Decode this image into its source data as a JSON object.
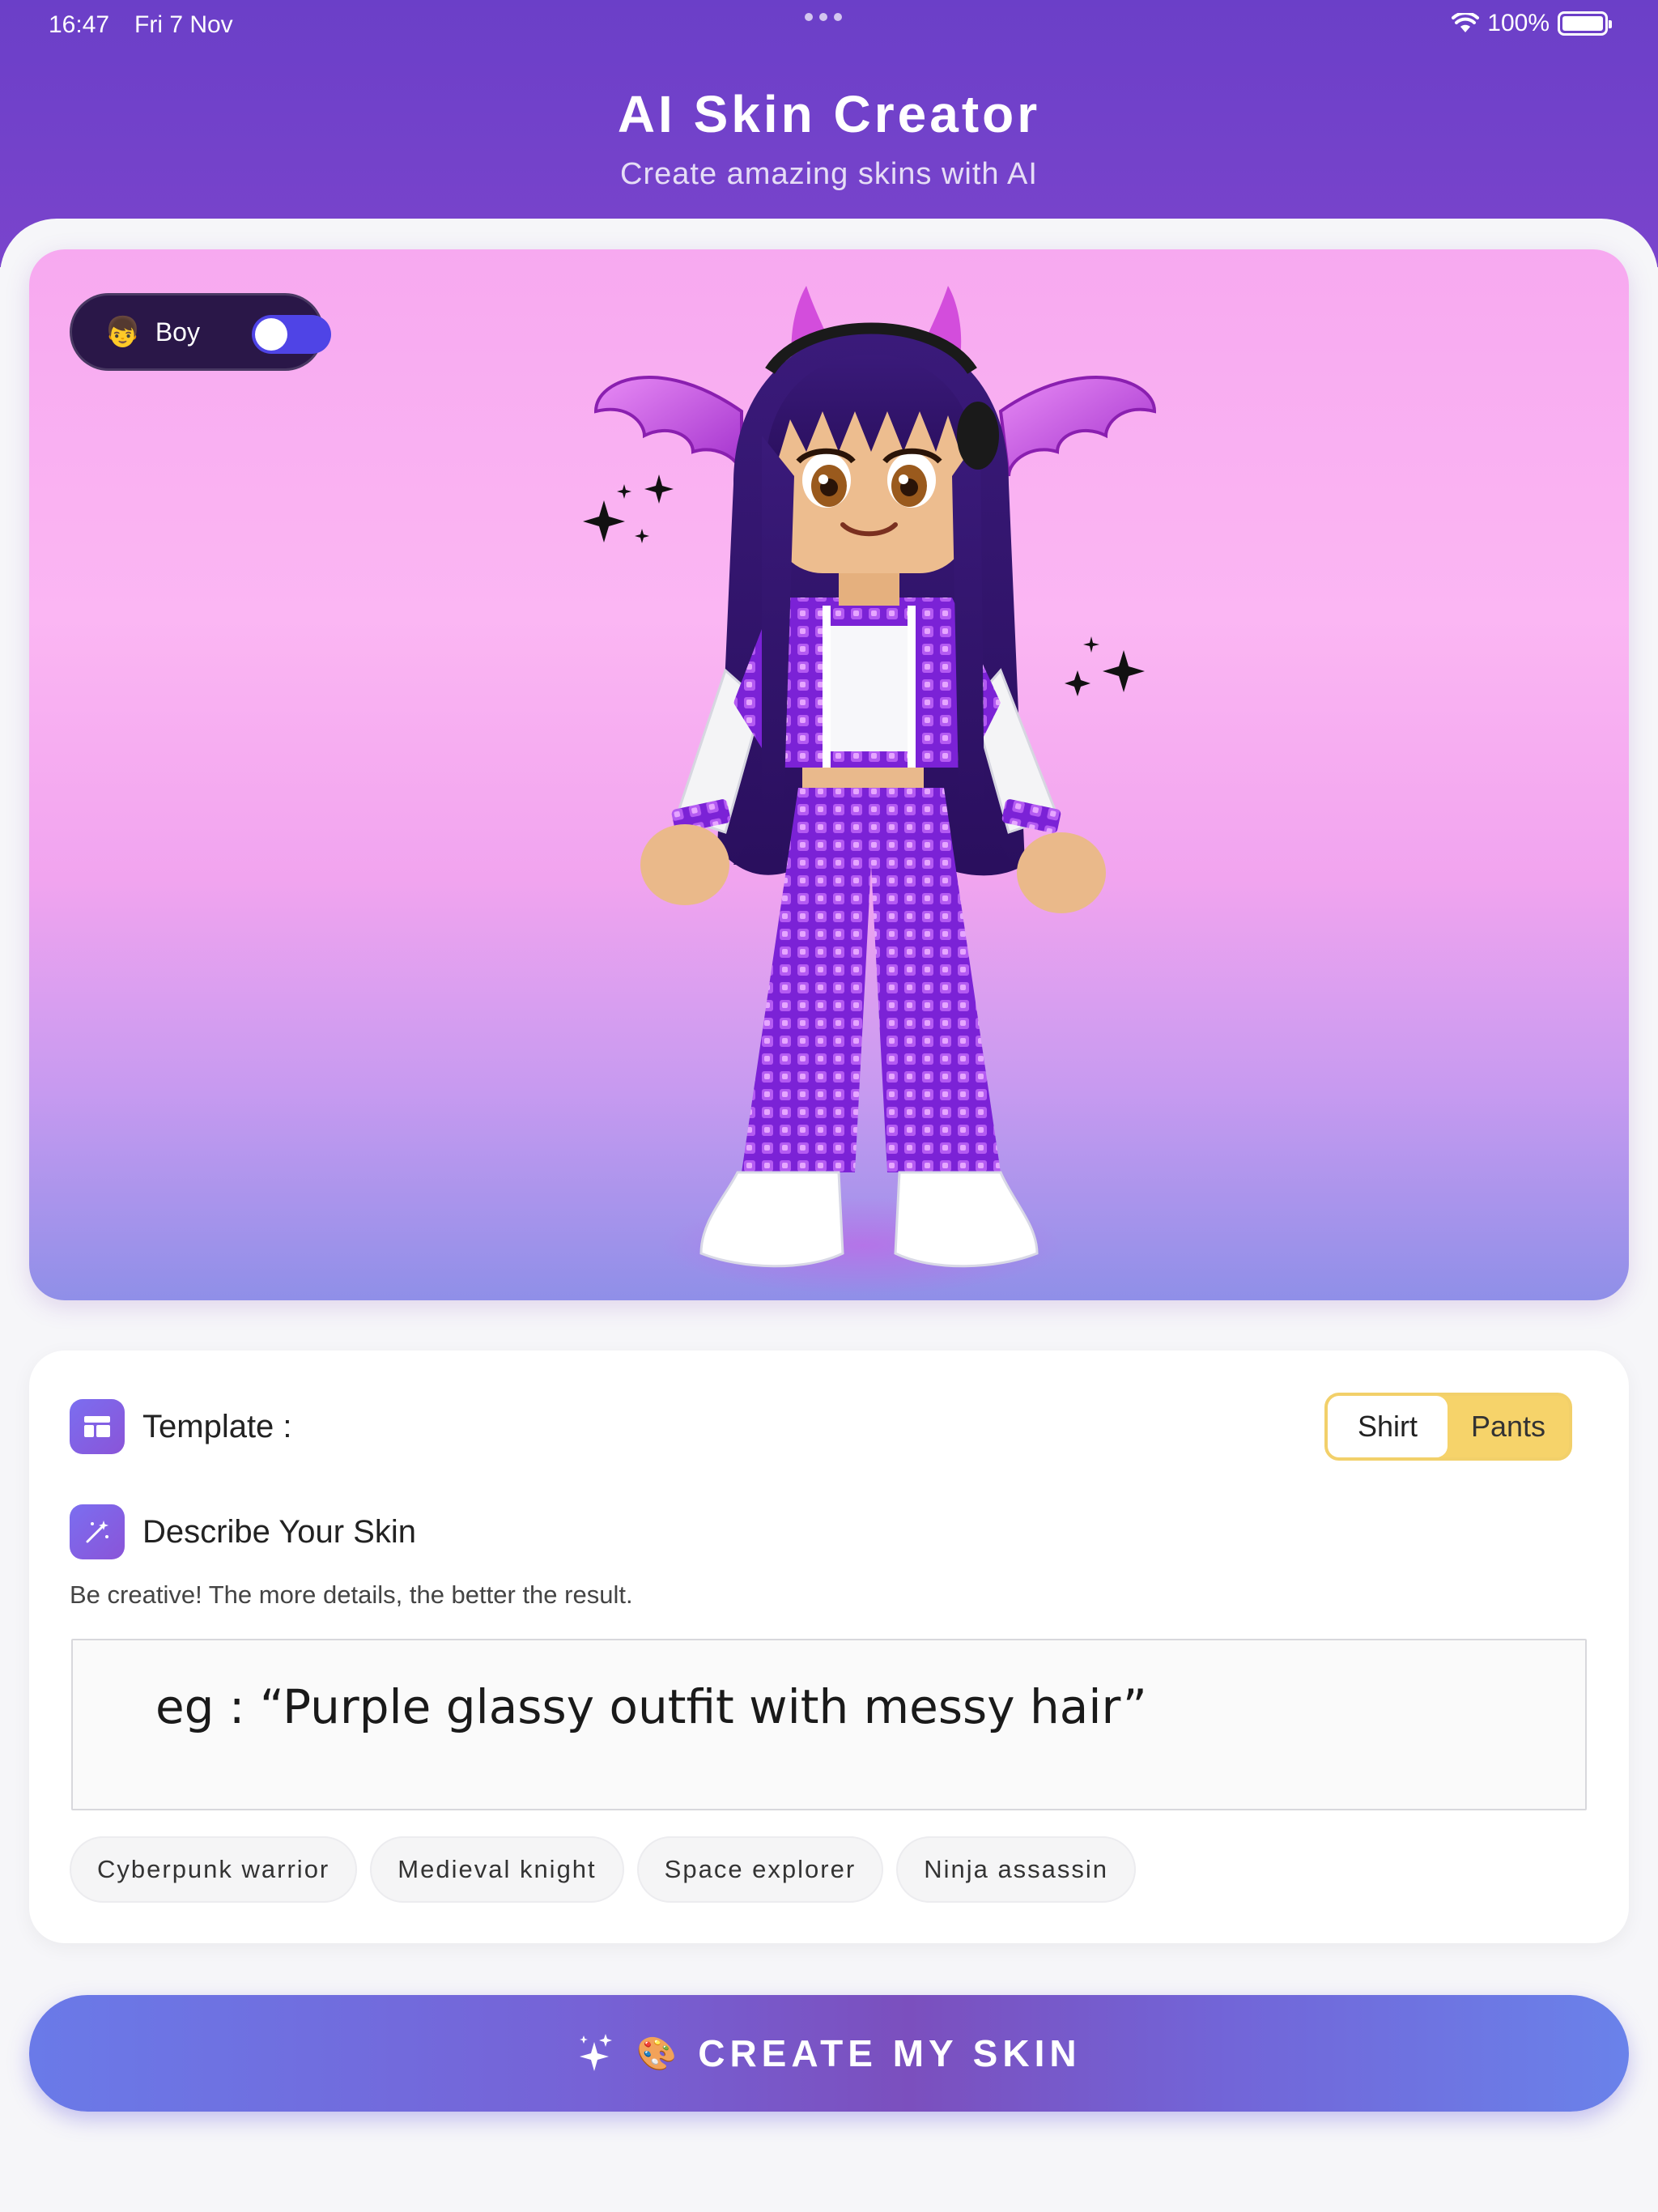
{
  "status_bar": {
    "time": "16:47",
    "date": "Fri 7 Nov",
    "battery": "100%"
  },
  "header": {
    "title": "AI Skin Creator",
    "subtitle": "Create amazing skins with AI"
  },
  "preview": {
    "gender_toggle_label": "Boy",
    "gender_emoji": "👦",
    "toggle_on": true
  },
  "template": {
    "label": "Template :",
    "options": [
      "Shirt",
      "Pants"
    ],
    "selected": "Shirt"
  },
  "describe": {
    "title": "Describe Your Skin",
    "hint": "Be creative! The more details, the better the result.",
    "placeholder": "eg : “Purple glassy outfit with messy hair”",
    "suggestions": [
      "Cyberpunk warrior",
      "Medieval knight",
      "Space explorer",
      "Ninja assassin"
    ]
  },
  "cta": {
    "label": "CREATE MY SKIN",
    "icons": [
      "sparkles-icon",
      "palette-icon"
    ]
  },
  "colors": {
    "header": "#6b3fc8",
    "toggle_bg": "#2a1748",
    "toggle_accent": "#4f44e6",
    "segment_active": "#f6d36a",
    "cta_start": "#6a7ae8",
    "cta_mid": "#7b4fbe"
  }
}
